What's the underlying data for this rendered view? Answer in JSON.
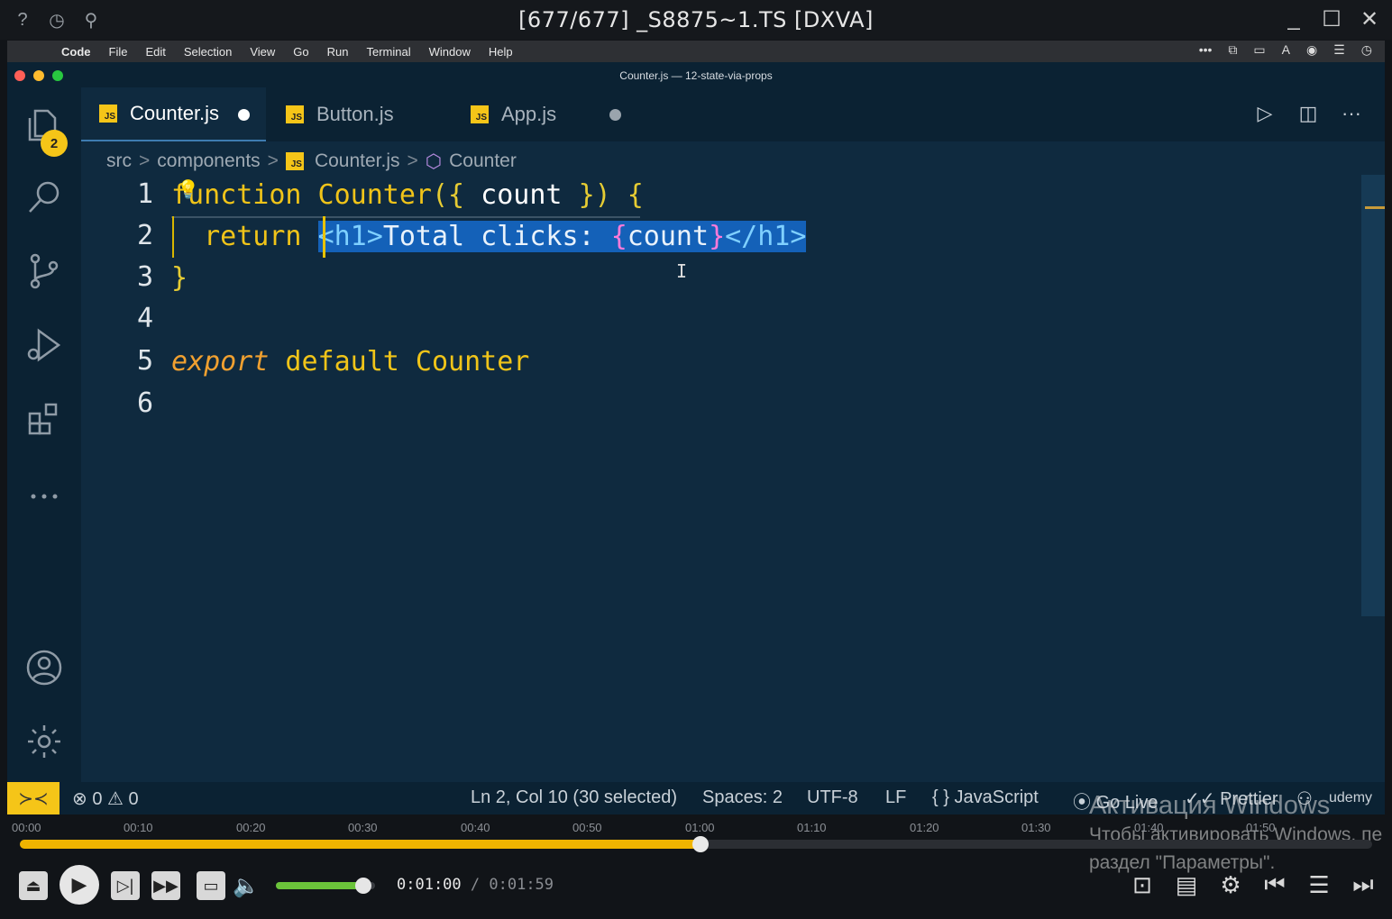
{
  "player": {
    "title": "[677/677] _S8875~1.TS [DXVA]",
    "timeline_labels": [
      "00:00",
      "00:10",
      "00:20",
      "00:30",
      "00:40",
      "00:50",
      "01:00",
      "01:10",
      "01:20",
      "01:30",
      "01:40",
      "01:50"
    ],
    "current_time": "0:01:00",
    "separator": " / ",
    "duration": "0:01:59",
    "progress_fraction": 0.503,
    "volume_fraction": 0.88
  },
  "mac_menu": {
    "app": "Code",
    "items": [
      "File",
      "Edit",
      "Selection",
      "View",
      "Go",
      "Run",
      "Terminal",
      "Window",
      "Help"
    ]
  },
  "window": {
    "title": "Counter.js — 12-state-via-props"
  },
  "activity": {
    "explorer_badge": "2"
  },
  "tabs": [
    {
      "label": "Counter.js",
      "icon": "JS",
      "modified": true,
      "active": true
    },
    {
      "label": "Button.js",
      "icon": "JS",
      "modified": false,
      "active": false
    },
    {
      "label": "App.js",
      "icon": "JS",
      "modified": true,
      "active": false
    }
  ],
  "breadcrumb": {
    "parts": [
      "src",
      "components",
      "Counter.js",
      "Counter"
    ],
    "separator": ">"
  },
  "editor": {
    "line_numbers": [
      "1",
      "2",
      "3",
      "4",
      "5",
      "6"
    ],
    "line1": {
      "kw": "function",
      "name": " Counter",
      "open": "({",
      "param": " count ",
      "close": "})",
      "brace": " {"
    },
    "line2": {
      "indent": "  ",
      "kw": "return",
      "space": " ",
      "tag_open": "<h1>",
      "text": "Total clicks: ",
      "expr_open": "{",
      "expr": "count",
      "expr_close": "}",
      "tag_close": "</h1>"
    },
    "line3": {
      "brace": "}"
    },
    "line5": {
      "kw1": "export",
      "kw2": " default",
      "name": " Counter"
    }
  },
  "status": {
    "errors": "0",
    "warnings": "0",
    "position": "Ln 2, Col 10 (30 selected)",
    "spaces": "Spaces: 2",
    "encoding": "UTF-8",
    "eol": "LF",
    "language": "JavaScript",
    "golive": "Go Live",
    "prettier": "Prettier",
    "udemy": "udemy"
  },
  "watermark": {
    "title": "Активация Windows",
    "line1": "Чтобы активировать Windows, пе",
    "line2": "раздел \"Параметры\"."
  },
  "colors": {
    "accent": "#f5c518",
    "selection": "#1461b8",
    "editor_bg": "#0f2a3f",
    "seek_fill": "#f0b400",
    "volume_fill": "#6bc43a",
    "light_red": "#ff5f57",
    "light_yellow": "#febc2e",
    "light_green": "#28c840"
  }
}
